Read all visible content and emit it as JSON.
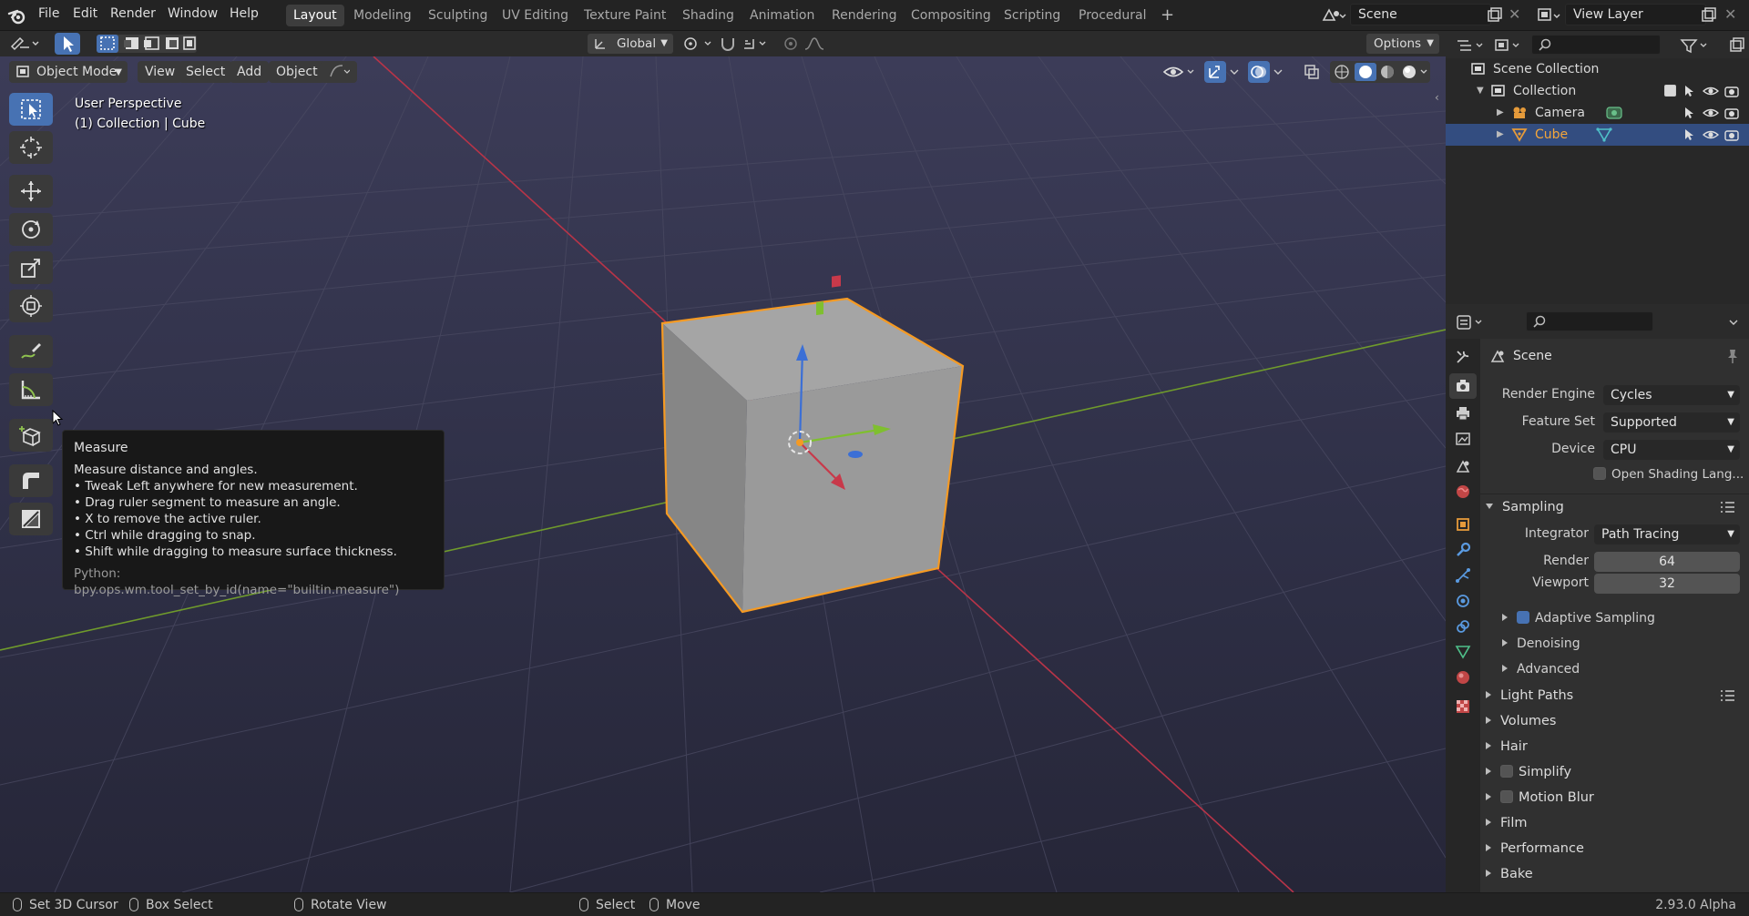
{
  "app": {
    "version": "2.93.0 Alpha"
  },
  "menu": {
    "file": "File",
    "edit": "Edit",
    "render": "Render",
    "window": "Window",
    "help": "Help"
  },
  "workspaces": [
    "Layout",
    "Modeling",
    "Sculpting",
    "UV Editing",
    "Texture Paint",
    "Shading",
    "Animation",
    "Rendering",
    "Compositing",
    "Scripting",
    "Procedural"
  ],
  "active_workspace": "Layout",
  "scene_name": "Scene",
  "view_layer_name": "View Layer",
  "header2": {
    "transform_orientation": "Global",
    "options": "Options"
  },
  "viewport": {
    "mode": "Object Mode",
    "menu": [
      "View",
      "Select",
      "Add",
      "Object"
    ],
    "perspective": "User Perspective",
    "collection_info": "(1) Collection | Cube"
  },
  "tooltip": {
    "title": "Measure",
    "description": "Measure distance and angles.",
    "bullets": [
      "• Tweak Left anywhere for new measurement.",
      "• Drag ruler segment to measure an angle.",
      "• X to remove the active ruler.",
      "• Ctrl while dragging to snap.",
      "• Shift while dragging to measure surface thickness."
    ],
    "python": "Python: bpy.ops.wm.tool_set_by_id(name=\"builtin.measure\")"
  },
  "outliner": {
    "scene_collection": "Scene Collection",
    "collection": "Collection",
    "camera": "Camera",
    "cube": "Cube"
  },
  "properties": {
    "context": "Scene",
    "render_engine_label": "Render Engine",
    "render_engine": "Cycles",
    "feature_set_label": "Feature Set",
    "feature_set": "Supported",
    "device_label": "Device",
    "device": "CPU",
    "osl": "Open Shading Lang...",
    "sampling": "Sampling",
    "integrator_label": "Integrator",
    "integrator": "Path Tracing",
    "render_label": "Render",
    "render_samples": "64",
    "viewport_label": "Viewport",
    "viewport_samples": "32",
    "adaptive": "Adaptive Sampling",
    "denoising": "Denoising",
    "advanced": "Advanced",
    "panels": [
      "Light Paths",
      "Volumes",
      "Hair",
      "Simplify",
      "Motion Blur",
      "Film",
      "Performance",
      "Bake"
    ]
  },
  "status": {
    "set_cursor": "Set 3D Cursor",
    "box_select": "Box Select",
    "rotate": "Rotate View",
    "select": "Select",
    "move": "Move"
  },
  "colors": {
    "accent": "#4772b3",
    "selection_outline": "#f59a23",
    "x_axis": "#c8394a",
    "y_axis": "#7fbf2f",
    "z_axis": "#3b6fd6"
  }
}
